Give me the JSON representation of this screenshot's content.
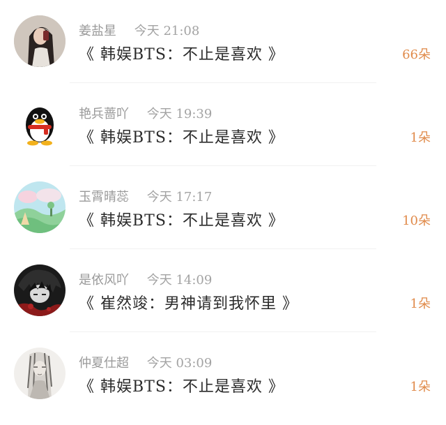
{
  "rows": [
    {
      "avatar_icon": "user-photo-avatar",
      "name": "姜盐星",
      "time": "今天 21:08",
      "title": "《 韩娱BTS：不止是喜欢 》",
      "count": "66朵"
    },
    {
      "avatar_icon": "qq-penguin-avatar",
      "name": "艳兵蔷吖",
      "time": "今天 19:39",
      "title": "《 韩娱BTS：不止是喜欢 》",
      "count": "1朵"
    },
    {
      "avatar_icon": "landscape-avatar",
      "name": "玉霄晴蕊",
      "time": "今天 17:17",
      "title": "《 韩娱BTS：不止是喜欢 》",
      "count": "10朵"
    },
    {
      "avatar_icon": "dark-anime-avatar",
      "name": "是依风吖",
      "time": "今天 14:09",
      "title": "《 崔然竣：男神请到我怀里 》",
      "count": "1朵"
    },
    {
      "avatar_icon": "sketch-avatar",
      "name": "仲夏仕超",
      "time": "今天 03:09",
      "title": "《 韩娱BTS：不止是喜欢 》",
      "count": "1朵"
    }
  ],
  "colors": {
    "accent": "#e08a4a",
    "meta_text": "#9a9a9a",
    "title_text": "#2b2b2b",
    "divider": "#f1f1f1"
  }
}
